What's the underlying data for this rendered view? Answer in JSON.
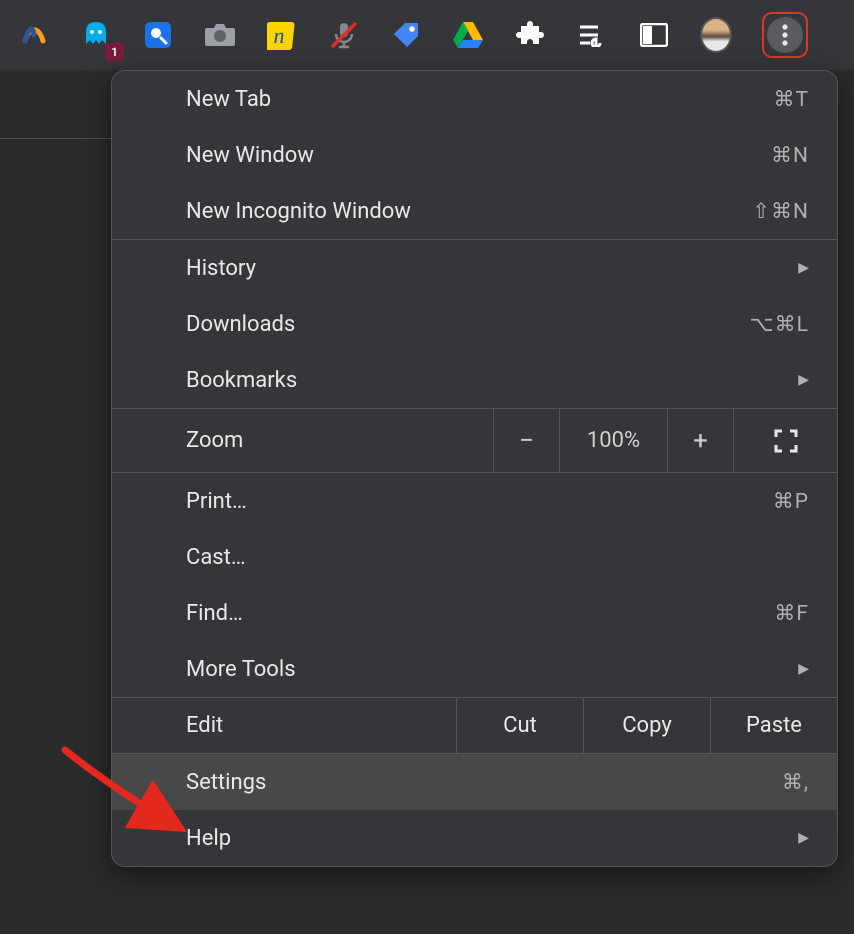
{
  "toolbar": {
    "badge": "1",
    "icons": [
      "similarweb-icon",
      "ghostery-icon",
      "picture-in-picture-icon",
      "screenshot-icon",
      "notion-icon",
      "mute-mic-icon",
      "price-tag-icon",
      "google-drive-icon",
      "extensions-icon",
      "media-control-icon",
      "side-panel-icon"
    ]
  },
  "menu": {
    "section1": [
      {
        "label": "New Tab",
        "shortcut": "⌘T"
      },
      {
        "label": "New Window",
        "shortcut": "⌘N"
      },
      {
        "label": "New Incognito Window",
        "shortcut": "⇧⌘N"
      }
    ],
    "section2": [
      {
        "label": "History",
        "submenu": true
      },
      {
        "label": "Downloads",
        "shortcut": "⌥⌘L"
      },
      {
        "label": "Bookmarks",
        "submenu": true
      }
    ],
    "zoom": {
      "label": "Zoom",
      "minus": "−",
      "pct": "100%",
      "plus": "+"
    },
    "section4": [
      {
        "label": "Print…",
        "shortcut": "⌘P"
      },
      {
        "label": "Cast…"
      },
      {
        "label": "Find…",
        "shortcut": "⌘F"
      },
      {
        "label": "More Tools",
        "submenu": true
      }
    ],
    "edit": {
      "label": "Edit",
      "cut": "Cut",
      "copy": "Copy",
      "paste": "Paste"
    },
    "section6": [
      {
        "label": "Settings",
        "shortcut": "⌘,",
        "highlighted": true
      },
      {
        "label": "Help",
        "submenu": true
      }
    ]
  }
}
